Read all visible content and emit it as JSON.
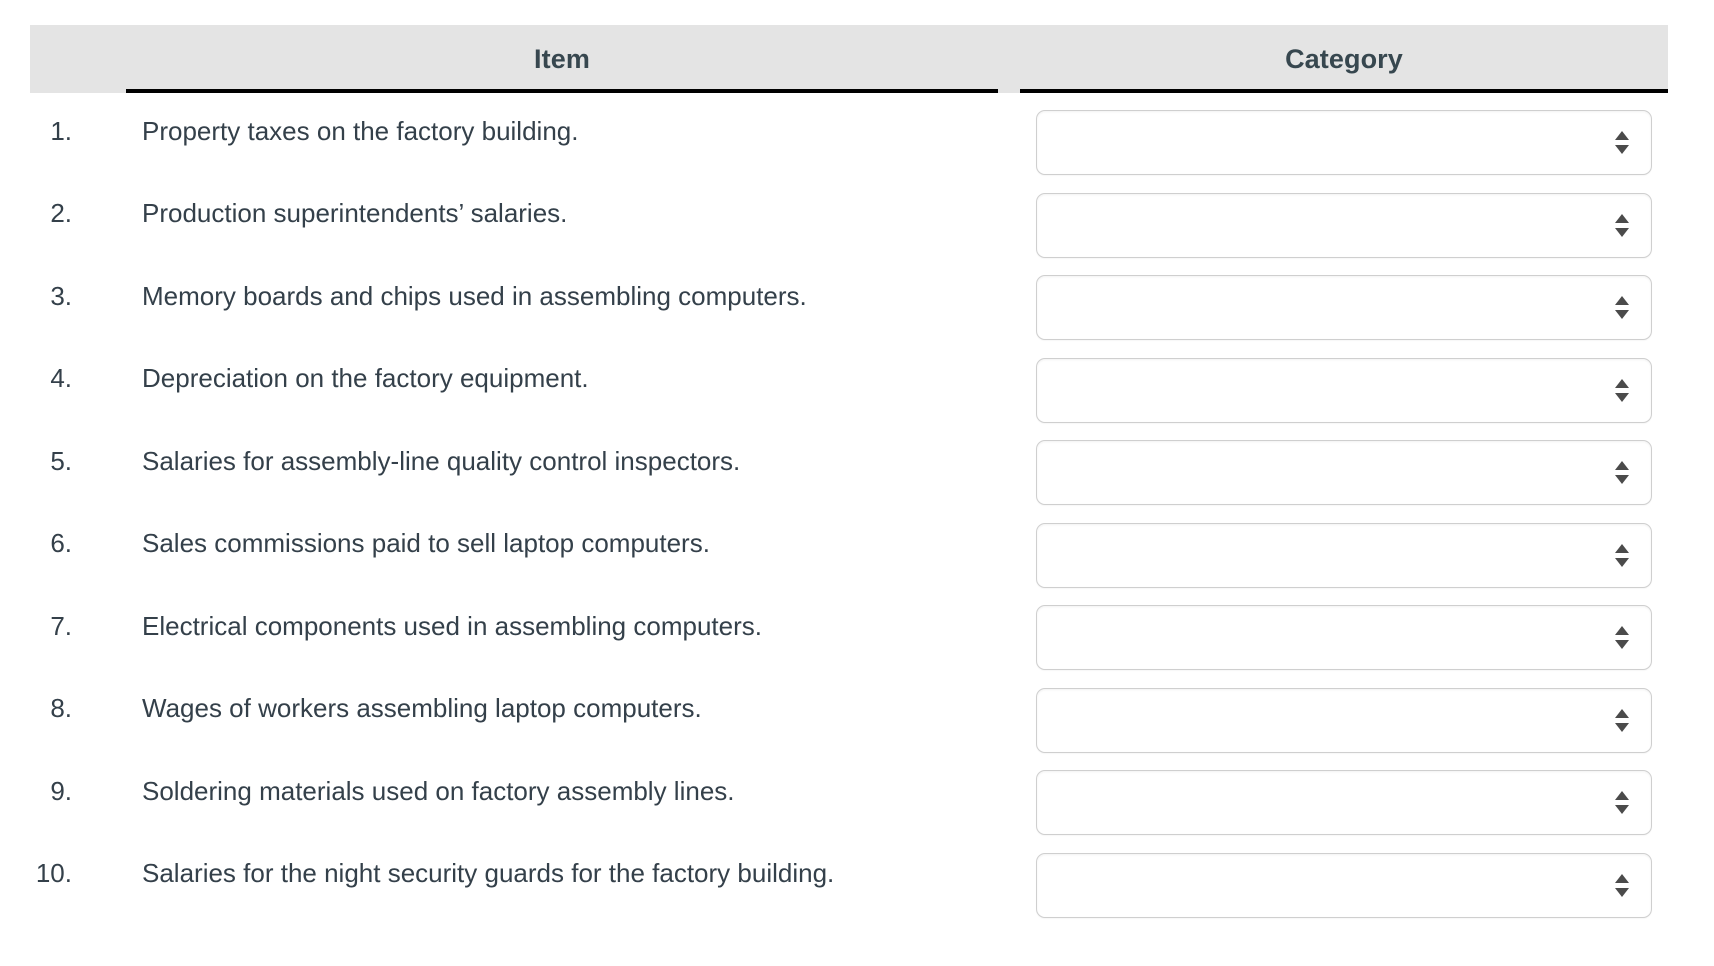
{
  "table": {
    "columns": [
      {
        "key": "item",
        "label": "Item"
      },
      {
        "key": "category",
        "label": "Category"
      }
    ],
    "rows": [
      {
        "num": "1.",
        "item": "Property taxes on the factory building.",
        "category_value": "",
        "category_placeholder": ""
      },
      {
        "num": "2.",
        "item": "Production superintendents’ salaries.",
        "category_value": "",
        "category_placeholder": ""
      },
      {
        "num": "3.",
        "item": "Memory boards and chips used in assembling computers.",
        "category_value": "",
        "category_placeholder": ""
      },
      {
        "num": "4.",
        "item": "Depreciation on the factory equipment.",
        "category_value": "",
        "category_placeholder": ""
      },
      {
        "num": "5.",
        "item": "Salaries for assembly-line quality control inspectors.",
        "category_value": "",
        "category_placeholder": ""
      },
      {
        "num": "6.",
        "item": "Sales commissions paid to sell laptop computers.",
        "category_value": "",
        "category_placeholder": ""
      },
      {
        "num": "7.",
        "item": "Electrical components used in assembling computers.",
        "category_value": "",
        "category_placeholder": ""
      },
      {
        "num": "8.",
        "item": "Wages of workers assembling laptop computers.",
        "category_value": "",
        "category_placeholder": ""
      },
      {
        "num": "9.",
        "item": "Soldering materials used on factory assembly lines.",
        "category_value": "",
        "category_placeholder": ""
      },
      {
        "num": "10.",
        "item": "Salaries for the night security guards for the factory building.",
        "category_value": "",
        "category_placeholder": ""
      }
    ]
  },
  "icons": {
    "select_up": "triangle-up-icon",
    "select_down": "triangle-down-icon"
  },
  "colors": {
    "header_background": "#e4e4e4",
    "header_text": "#37474f",
    "body_text": "#34404a",
    "page_background": "#ffffff",
    "rule": "#000000",
    "select_border": "#cfcfcf",
    "select_arrow": "#4b4b4b"
  }
}
